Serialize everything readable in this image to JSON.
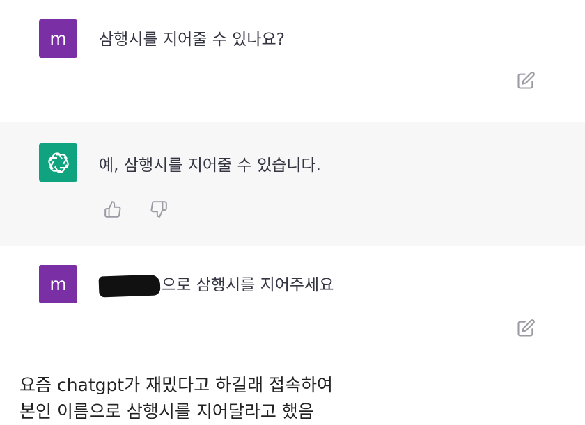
{
  "messages": [
    {
      "role": "user",
      "avatar_letter": "m",
      "text": "삼행시를 지어줄 수 있나요?"
    },
    {
      "role": "assistant",
      "text": "예, 삼행시를 지어줄 수 있습니다."
    },
    {
      "role": "user",
      "avatar_letter": "m",
      "text_suffix": "으로 삼행시를 지어주세요"
    }
  ],
  "icons": {
    "edit": "edit-icon",
    "thumbs_up": "thumbs-up-icon",
    "thumbs_down": "thumbs-down-icon",
    "assistant_logo": "openai-logo-icon"
  },
  "colors": {
    "user_avatar": "#7b2fa5",
    "assistant_avatar": "#10a37f",
    "assistant_bg": "#f7f7f8"
  },
  "caption": {
    "line1": "요즘 chatgpt가 재밌다고 하길래 접속하여",
    "line2": "본인 이름으로 삼행시를 지어달라고 했음"
  }
}
